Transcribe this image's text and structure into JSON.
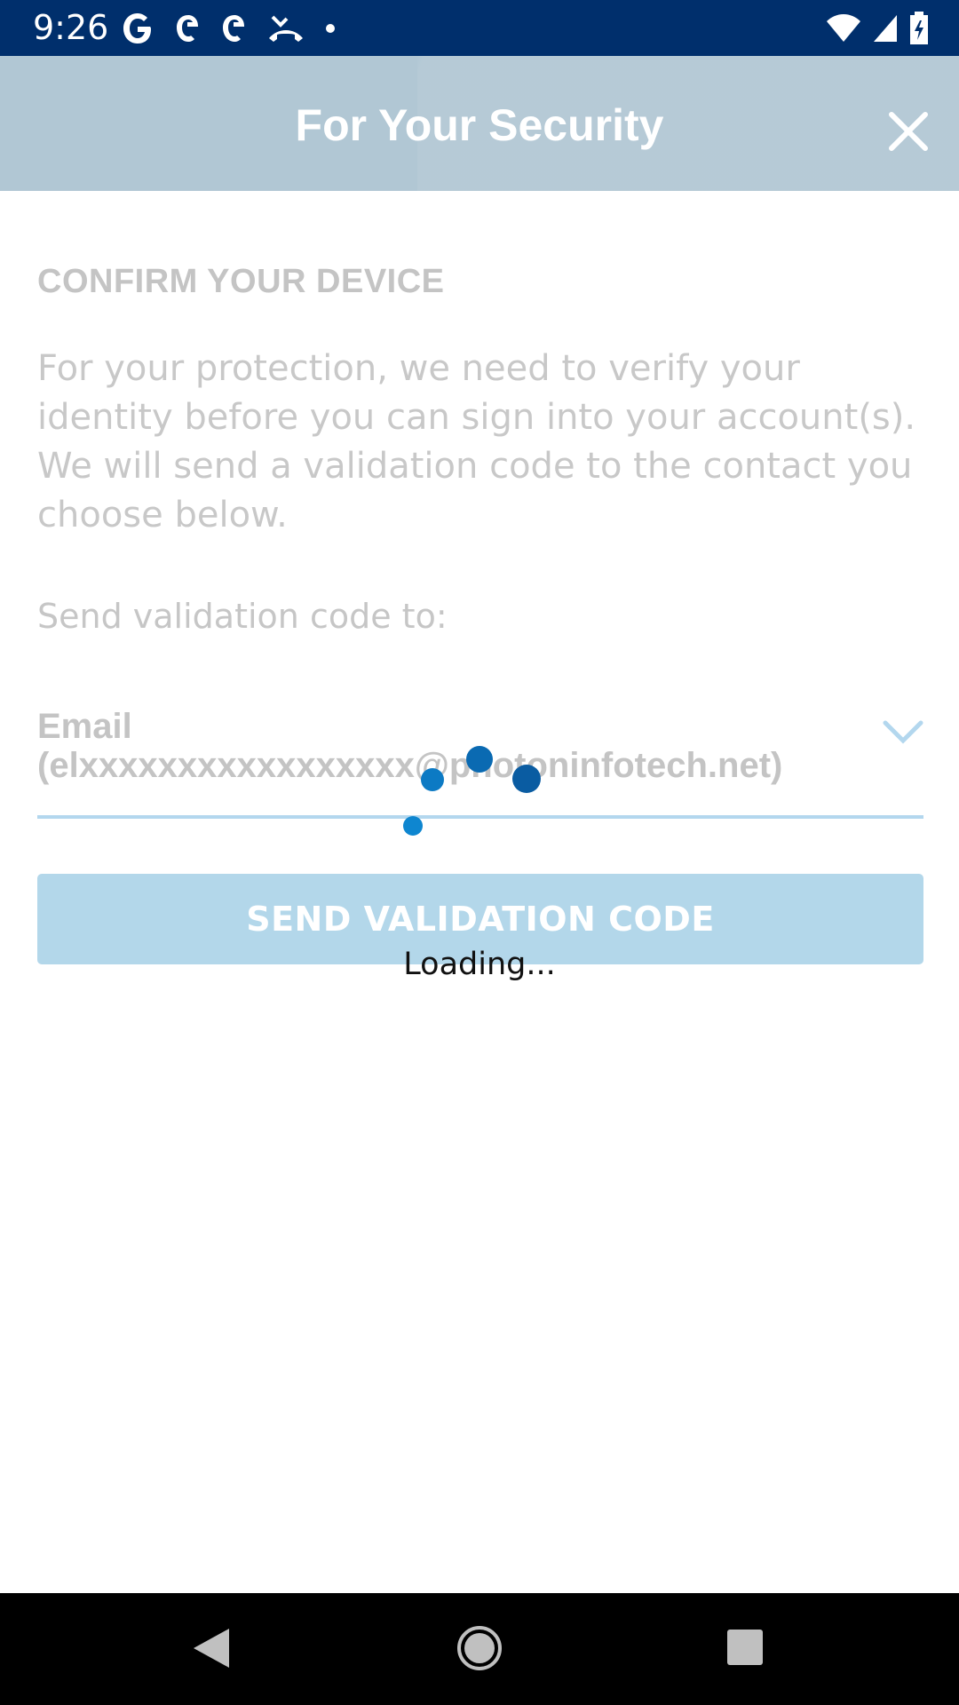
{
  "status_bar": {
    "time": "9:26",
    "left_icons": [
      "google-icon",
      "notification-app-icon",
      "notification-app-icon",
      "missed-call-icon",
      "dot-icon"
    ],
    "right_icons": [
      "wifi-icon",
      "cell-signal-icon",
      "battery-icon"
    ]
  },
  "header": {
    "title": "For Your Security",
    "background": "#b1c7d4"
  },
  "content": {
    "section_title": "CONFIRM YOUR DEVICE",
    "description": "For your protection, we need to verify your identity before you can sign into your account(s). We will send a validation code to the contact you choose below.",
    "send_to_label": "Send validation code to:",
    "contact_select": {
      "line1": "Email",
      "line2": "(elxxxxxxxxxxxxxxxxx@photoninfotech.net)"
    },
    "send_button_label": "SEND VALIDATION CODE",
    "button_color": "#b3d7ea"
  },
  "loading": {
    "text": "Loading...",
    "spinner_color": "#0a6ab2"
  },
  "nav_bar": {
    "buttons": [
      "back-icon",
      "home-icon",
      "recents-icon"
    ]
  }
}
